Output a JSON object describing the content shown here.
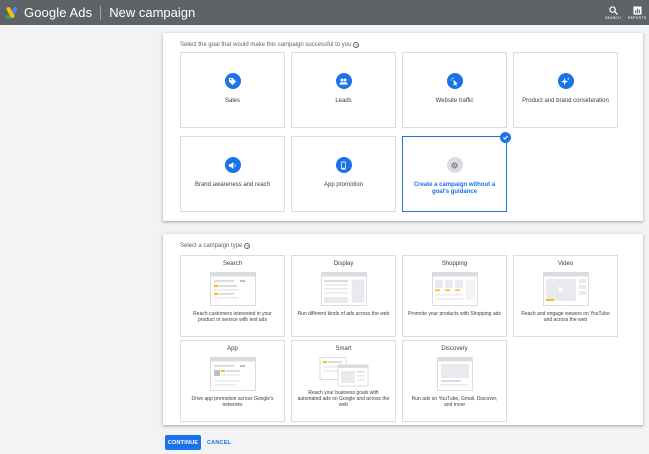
{
  "header": {
    "brand": "Google Ads",
    "page_title": "New campaign",
    "actions": [
      {
        "label": "SEARCH",
        "icon": "search-icon"
      },
      {
        "label": "REPORTS",
        "icon": "reports-icon"
      }
    ]
  },
  "goal_section": {
    "label": "Select the goal that would make this campaign successful to you",
    "goals": [
      {
        "label": "Sales",
        "icon": "tag-icon"
      },
      {
        "label": "Leads",
        "icon": "people-icon"
      },
      {
        "label": "Website traffic",
        "icon": "cursor-click-icon"
      },
      {
        "label": "Product and brand consideration",
        "icon": "sparkle-icon"
      },
      {
        "label": "Brand awareness and reach",
        "icon": "speaker-icon"
      },
      {
        "label": "App promotion",
        "icon": "phone-icon"
      },
      {
        "label": "Create a campaign without a goal's guidance",
        "icon": "gear-icon",
        "selected": true
      }
    ]
  },
  "type_section": {
    "label": "Select a campaign type",
    "types": [
      {
        "title": "Search",
        "description": "Reach customers interested in your product or service with text ads"
      },
      {
        "title": "Display",
        "description": "Run different kinds of ads across the web"
      },
      {
        "title": "Shopping",
        "description": "Promote your products with Shopping ads"
      },
      {
        "title": "Video",
        "description": "Reach and engage viewers on YouTube and across the web"
      },
      {
        "title": "App",
        "description": "Drive app promotion across Google's networks"
      },
      {
        "title": "Smart",
        "description": "Reach your business goals with automated ads on Google and across the web"
      },
      {
        "title": "Discovery",
        "description": "Run ads on YouTube, Gmail, Discover, and more"
      }
    ]
  },
  "footer": {
    "continue_label": "CONTINUE",
    "cancel_label": "CANCEL"
  },
  "colors": {
    "topbar": "#5f6368",
    "accent": "#1a73e8",
    "background": "#f1f3f4"
  }
}
